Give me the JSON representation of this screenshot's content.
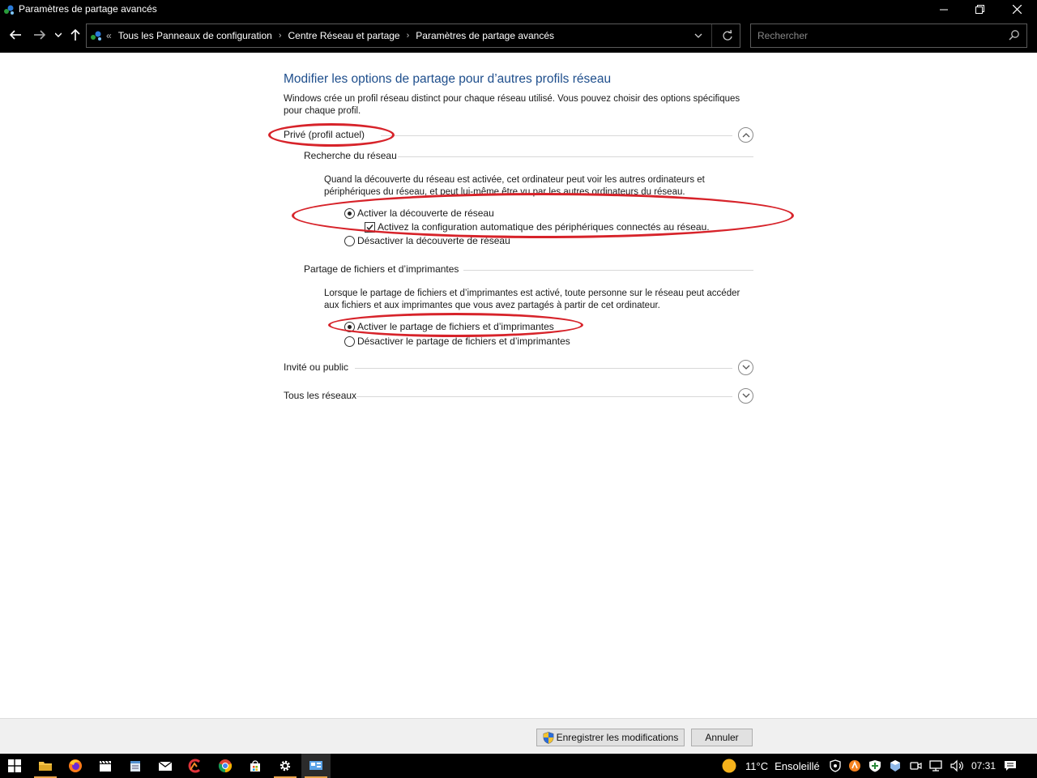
{
  "window": {
    "title": "Paramètres de partage avancés"
  },
  "address": {
    "overflow": "«",
    "crumbs": [
      "Tous les Panneaux de configuration",
      "Centre Réseau et partage",
      "Paramètres de partage avancés"
    ]
  },
  "search": {
    "placeholder": "Rechercher"
  },
  "main": {
    "heading": "Modifier les options de partage pour d’autres profils réseau",
    "description": "Windows crée un profil réseau distinct pour chaque réseau utilisé. Vous pouvez choisir des options spécifiques pour chaque profil.",
    "profiles": [
      {
        "label": "Privé (profil actuel)",
        "expanded": true,
        "sections": [
          {
            "title": "Recherche du réseau",
            "text": "Quand la découverte du réseau est activée, cet ordinateur peut voir les autres ordinateurs et périphériques du réseau, et peut lui-même être vu par les autres ordinateurs du réseau.",
            "options": [
              {
                "label": "Activer la découverte de réseau",
                "selected": true
              },
              {
                "label": "Désactiver la découverte de réseau",
                "selected": false
              }
            ],
            "checkbox": {
              "label": "Activez la configuration automatique des périphériques connectés au réseau.",
              "checked": true
            }
          },
          {
            "title": "Partage de fichiers et d’imprimantes",
            "text": "Lorsque le partage de fichiers et d’imprimantes est activé, toute personne sur le réseau peut accéder aux fichiers et aux imprimantes que vous avez partagés à partir de cet ordinateur.",
            "options": [
              {
                "label": "Activer le partage de fichiers et d’imprimantes",
                "selected": true
              },
              {
                "label": "Désactiver le partage de fichiers et d’imprimantes",
                "selected": false
              }
            ]
          }
        ]
      },
      {
        "label": "Invité ou public",
        "expanded": false
      },
      {
        "label": "Tous les réseaux",
        "expanded": false
      }
    ]
  },
  "buttons": {
    "save": "Enregistrer les modifications",
    "cancel": "Annuler"
  },
  "taskbar": {
    "apps": [
      "start-icon",
      "file-explorer-icon",
      "firefox-icon",
      "clapper-icon",
      "notepad-icon",
      "mail-icon",
      "ccleaner-icon",
      "chrome-icon",
      "store-icon",
      "settings-icon",
      "control-panel-icon"
    ],
    "weather_temp": "11°C",
    "weather_text": "Ensoleillé",
    "clock": "07:31"
  },
  "colors": {
    "heading": "#1e4e8c",
    "annotation": "#d7232a",
    "active_underline": "#e8a44a"
  }
}
